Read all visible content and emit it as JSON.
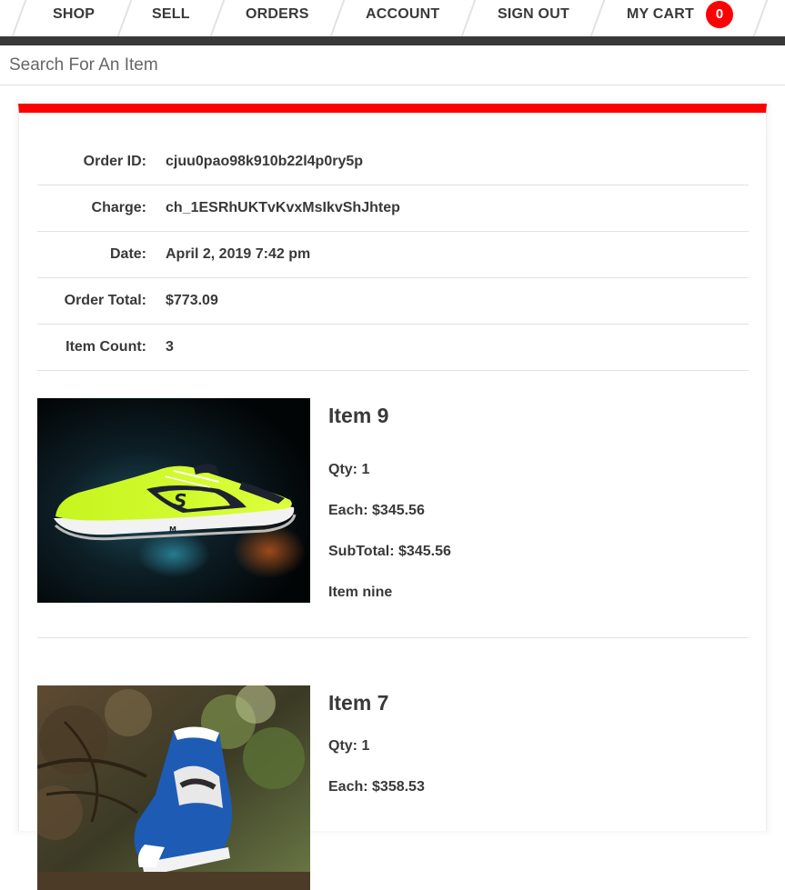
{
  "nav": {
    "links": [
      "SHOP",
      "SELL",
      "ORDERS",
      "ACCOUNT",
      "SIGN OUT",
      "MY CART"
    ],
    "cart_count": "0",
    "bar_color": "#393939",
    "accent_color": "#ff0000"
  },
  "search": {
    "placeholder": "Search For An Item",
    "value": ""
  },
  "order": {
    "rows": [
      {
        "label": "Order ID:",
        "value": "cjuu0pao98k910b22l4p0ry5p"
      },
      {
        "label": "Charge:",
        "value": "ch_1ESRhUKTvKvxMsIkvShJhtep"
      },
      {
        "label": "Date:",
        "value": "April 2, 2019 7:42 pm"
      },
      {
        "label": "Order Total:",
        "value": "$773.09"
      },
      {
        "label": "Item Count:",
        "value": "3"
      }
    ],
    "items": [
      {
        "title": "Item 9",
        "qty": "Qty: 1",
        "each": "Each: $345.56",
        "subtotal": "SubTotal: $345.56",
        "description": "Item nine",
        "image_icon": "running-shoe-image"
      },
      {
        "title": "Item 7",
        "qty": "Qty: 1",
        "each": "Each: $358.53",
        "image_icon": "high-top-sneaker-image"
      }
    ]
  }
}
